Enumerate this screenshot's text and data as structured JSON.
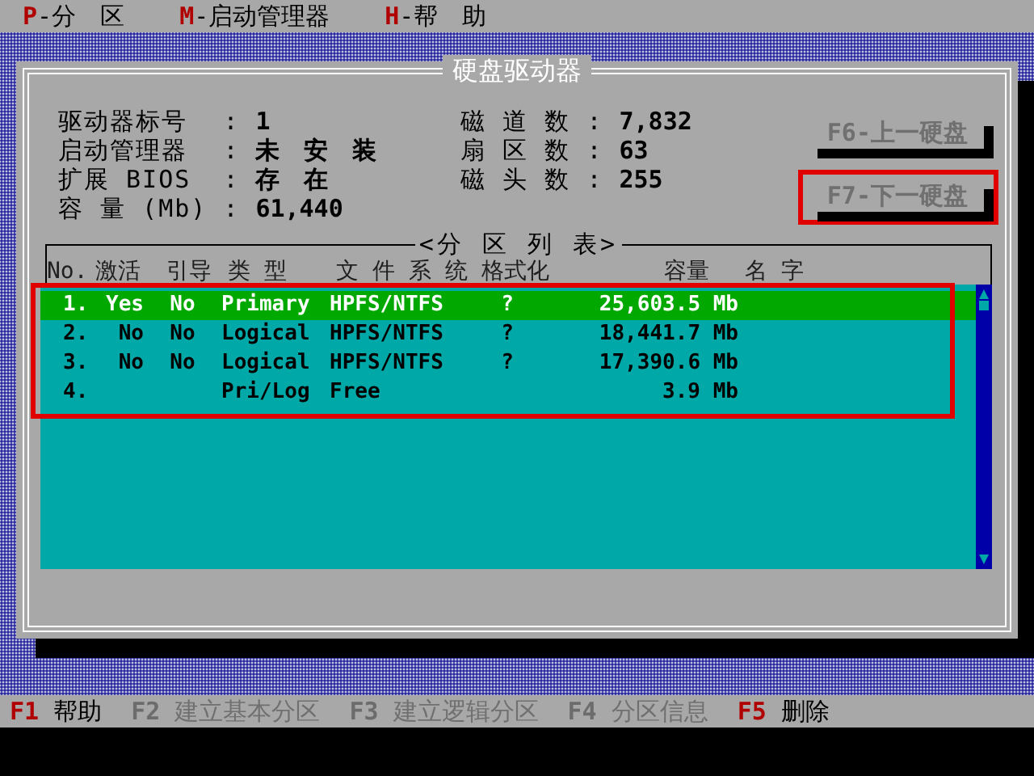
{
  "menu": [
    {
      "key": "P",
      "label": "-分　区"
    },
    {
      "key": "M",
      "label": "-启动管理器"
    },
    {
      "key": "H",
      "label": "-帮　助"
    }
  ],
  "dialog": {
    "title": "硬盘驱动器",
    "disk_info": [
      {
        "label": "驱动器标号",
        "sep": ":",
        "value": "1"
      },
      {
        "label": "启动管理器",
        "sep": ":",
        "value": "未　安　装"
      },
      {
        "label": "扩展 BIOS",
        "sep": ":",
        "value": "存　在"
      },
      {
        "label": "容 量 (Mb)",
        "sep": ":",
        "value": "61,440"
      }
    ],
    "geometry": [
      {
        "label": "磁 道 数",
        "sep": ":",
        "value": "7,832"
      },
      {
        "label": "扇 区 数",
        "sep": ":",
        "value": "63"
      },
      {
        "label": "磁 头 数",
        "sep": ":",
        "value": "255"
      }
    ],
    "buttons": [
      {
        "label": "F6-上一硬盘",
        "disabled": true,
        "highlighted": false
      },
      {
        "label": "F7-下一硬盘",
        "disabled": true,
        "highlighted": true
      }
    ],
    "partition_list": {
      "title": "<分 区 列 表>",
      "highlighted": true,
      "columns": [
        "No.",
        "激活",
        "引导",
        "类 型",
        "文 件 系 统",
        "格式化",
        "容量",
        "名 字"
      ],
      "rows": [
        {
          "cells": [
            "1.",
            "Yes",
            "No",
            "Primary",
            "HPFS/NTFS",
            "?",
            "25,603.5 Mb"
          ],
          "selected": true
        },
        {
          "cells": [
            "2.",
            "No",
            "No",
            "Logical",
            "HPFS/NTFS",
            "?",
            "18,441.7 Mb"
          ],
          "selected": false
        },
        {
          "cells": [
            "3.",
            "No",
            "No",
            "Logical",
            "HPFS/NTFS",
            "?",
            "17,390.6 Mb"
          ],
          "selected": false
        },
        {
          "cells": [
            "4.",
            "",
            "",
            "Pri/Log",
            "Free",
            "",
            "3.9 Mb"
          ],
          "selected": false
        }
      ]
    }
  },
  "function_keys": [
    {
      "key": "F1",
      "label": "帮助",
      "disabled": false
    },
    {
      "key": "F2",
      "label": "建立基本分区",
      "disabled": true
    },
    {
      "key": "F3",
      "label": "建立逻辑分区",
      "disabled": true
    },
    {
      "key": "F4",
      "label": "分区信息",
      "disabled": true
    },
    {
      "key": "F5",
      "label": "删除",
      "disabled": false
    }
  ]
}
